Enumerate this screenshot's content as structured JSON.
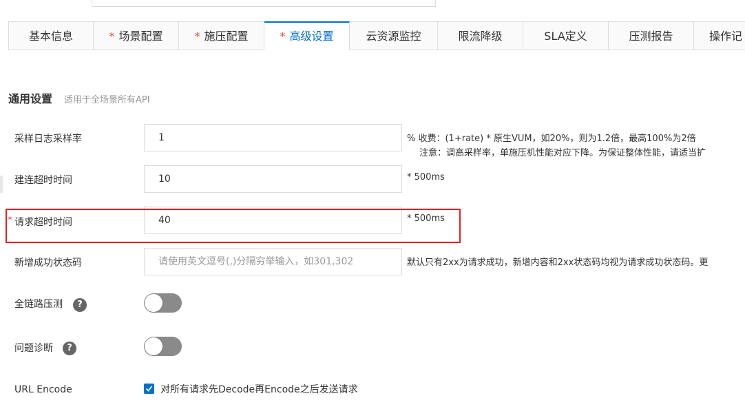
{
  "tabs": [
    {
      "label": "基本信息",
      "required": "",
      "active": false
    },
    {
      "label": "场景配置",
      "required": "*",
      "active": false
    },
    {
      "label": "施压配置",
      "required": "*",
      "active": false
    },
    {
      "label": "高级设置",
      "required": "*",
      "active": true
    },
    {
      "label": "云资源监控",
      "required": "",
      "active": false
    },
    {
      "label": "限流降级",
      "required": "",
      "active": false
    },
    {
      "label": "SLA定义",
      "required": "",
      "active": false
    },
    {
      "label": "压测报告",
      "required": "",
      "active": false
    },
    {
      "label": "操作记",
      "required": "",
      "active": false
    }
  ],
  "section": {
    "title": "通用设置",
    "hint": "适用于全场景所有API"
  },
  "fields": {
    "sample_rate": {
      "label": "采样日志采样率",
      "value": "1",
      "suffix_line1": "%  收费：(1+rate) * 原生VUM，如20%，则为1.2倍，最高100%为2倍",
      "suffix_line2": "注意：调高采样率，单施压机性能对应下降。为保证整体性能，请适当扩"
    },
    "connect_timeout": {
      "label": "建连超时时间",
      "value": "10",
      "suffix": "*  500ms"
    },
    "request_timeout": {
      "required": "*",
      "label": "请求超时时间",
      "value": "40",
      "suffix": "*  500ms"
    },
    "success_codes": {
      "label": "新增成功状态码",
      "value": "",
      "placeholder": "请使用英文逗号(,)分隔穷举输入，如301,302",
      "suffix": "默认只有2xx为请求成功，新增内容和2xx状态码均视为请求成功状态码。更"
    },
    "full_link": {
      "label": "全链路压测",
      "help": "?",
      "enabled": false
    },
    "diagnosis": {
      "label": "问题诊断",
      "help": "?",
      "enabled": false
    },
    "url_encode": {
      "label": "URL Encode",
      "checked": true,
      "checkbox_label": "对所有请求先Decode再Encode之后发送请求"
    }
  },
  "colors": {
    "accent": "#0070cc",
    "required": "#e14c4c",
    "highlight": "#e02020",
    "switch_off": "#8a8a8a"
  }
}
